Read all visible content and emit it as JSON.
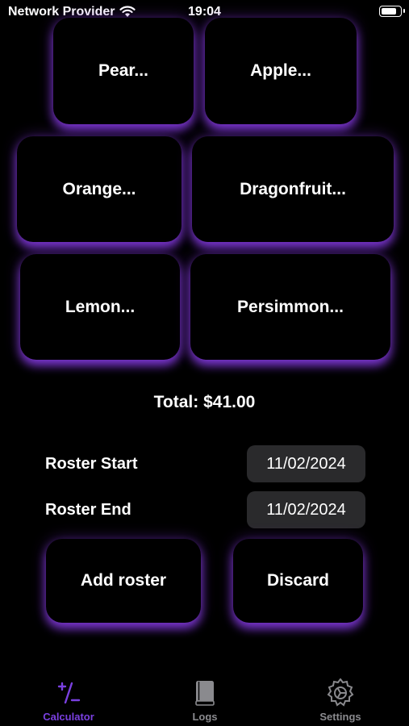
{
  "status_bar": {
    "carrier": "Network Provider",
    "time": "19:04",
    "battery_level": 0.9
  },
  "fruits": [
    {
      "label": "Pear..."
    },
    {
      "label": "Apple..."
    },
    {
      "label": "Orange..."
    },
    {
      "label": "Dragonfruit..."
    },
    {
      "label": "Lemon..."
    },
    {
      "label": "Persimmon..."
    }
  ],
  "total": {
    "text": "Total: $41.00"
  },
  "roster": {
    "start_label": "Roster Start",
    "start_value": "11/02/2024",
    "end_label": "Roster End",
    "end_value": "11/02/2024"
  },
  "actions": {
    "add_label": "Add roster",
    "discard_label": "Discard"
  },
  "tabs": [
    {
      "label": "Calculator",
      "icon": "plus-minus-icon",
      "active": true
    },
    {
      "label": "Logs",
      "icon": "book-icon",
      "active": false
    },
    {
      "label": "Settings",
      "icon": "gear-icon",
      "active": false
    }
  ],
  "colors": {
    "accent": "#7a40e0",
    "glow": "#8038d8",
    "inactive_tab": "#8a8a8e",
    "date_field": "#2a2a2c"
  }
}
